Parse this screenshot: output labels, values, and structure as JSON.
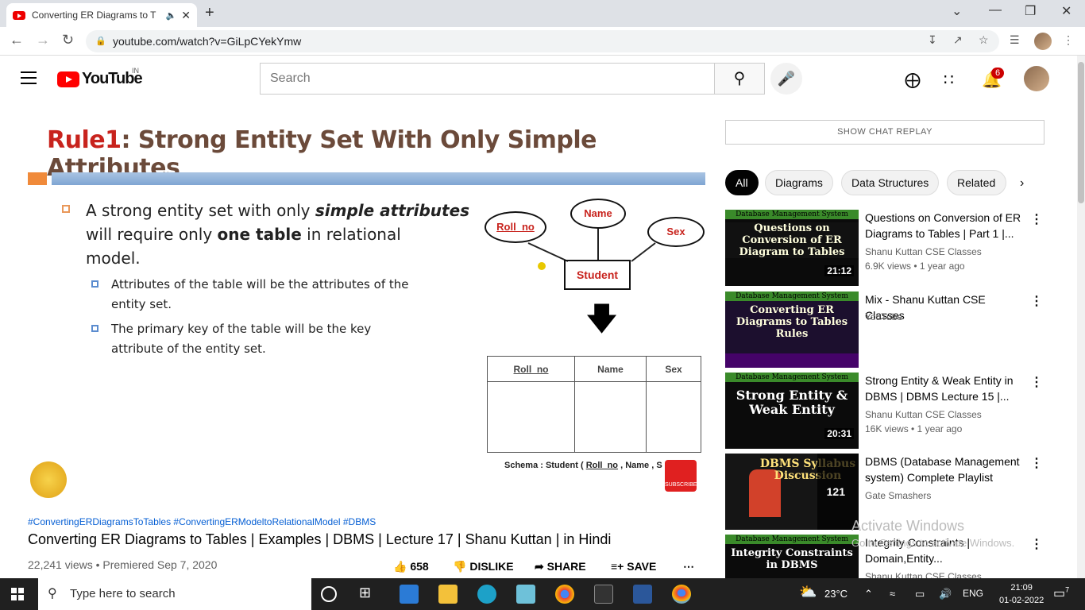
{
  "browser": {
    "tab_title": "Converting ER Diagrams to T",
    "url": "youtube.com/watch?v=GiLpCYekYmw"
  },
  "youtube": {
    "logo_text": "YouTube",
    "country_code": "IN",
    "search_placeholder": "Search",
    "notification_count": "6"
  },
  "slide": {
    "rule": "Rule1",
    "title": ": Strong Entity Set With Only Simple Attributes",
    "bullet1_a": "A strong entity set with only ",
    "bullet1_b": "simple attributes",
    "bullet1_c": "will require only ",
    "bullet1_d": "one table",
    "bullet1_e": " in relational",
    "bullet1_f": "model.",
    "sub1_a": "Attributes of the table will be the attributes of the",
    "sub1_b": "entity set.",
    "sub2_a": "The primary key of the table will be the key",
    "sub2_b": "attribute of the entity set.",
    "attr_rollno": "Roll_no",
    "attr_name": "Name",
    "attr_sex": "Sex",
    "entity": "Student",
    "table_cols": [
      "Roll_no",
      "Name",
      "Sex"
    ],
    "schema_a": "Schema : Student ( ",
    "schema_b": "Roll_no",
    "schema_c": " , Name , S",
    "subscribe": "SUBSCRIBE"
  },
  "video": {
    "tags": "#ConvertingERDiagramsToTables #ConvertingERModeltoRelationalModel #DBMS",
    "title": "Converting ER Diagrams to Tables | Examples | DBMS | Lecture 17 | Shanu Kuttan | in Hindi",
    "views": "22,241 views • Premiered Sep 7, 2020",
    "likes": "658",
    "dislike": "DISLIKE",
    "share": "SHARE",
    "save": "SAVE"
  },
  "sidebar": {
    "chat_replay": "SHOW CHAT REPLAY",
    "chips": [
      "All",
      "Diagrams",
      "Data Structures",
      "Related"
    ],
    "items": [
      {
        "thumb_hdr": "Database Management System",
        "thumb_text": "Questions on Conversion of ER Diagram to Tables",
        "duration": "21:12",
        "title": "Questions on Conversion of ER Diagrams to Tables | Part 1 |...",
        "channel": "Shanu Kuttan CSE Classes",
        "meta": "6.9K views • 1 year ago"
      },
      {
        "thumb_hdr": "Database Management System",
        "thumb_text": "Converting ER Diagrams to Tables Rules",
        "duration": "",
        "title": "Mix - Shanu Kuttan CSE Classes",
        "channel": "YouTube",
        "meta": ""
      },
      {
        "thumb_hdr": "Database Management System",
        "thumb_text": "Strong Entity & Weak Entity",
        "duration": "20:31",
        "title": "Strong Entity & Weak Entity in DBMS | DBMS Lecture 15 |...",
        "channel": "Shanu Kuttan CSE Classes",
        "meta": "16K views • 1 year ago"
      },
      {
        "thumb_hdr": "",
        "thumb_text": "DBMS Syllabus Discussion",
        "duration": "121",
        "title": "DBMS (Database Management system) Complete Playlist",
        "channel": "Gate Smashers",
        "meta": ""
      },
      {
        "thumb_hdr": "Database Management System",
        "thumb_text": "Integrity Constraints in DBMS",
        "duration": "",
        "title": "Integrity Constraints | Domain,Entity...",
        "channel": "Shanu Kuttan CSE Classes",
        "meta": ""
      }
    ]
  },
  "watermark": {
    "line1": "Activate Windows",
    "line2": "Go to Settings to activate Windows."
  },
  "taskbar": {
    "search_placeholder": "Type here to search",
    "temperature": "23°C",
    "language": "ENG",
    "time": "21:09",
    "date": "01-02-2022",
    "notif": "7"
  }
}
